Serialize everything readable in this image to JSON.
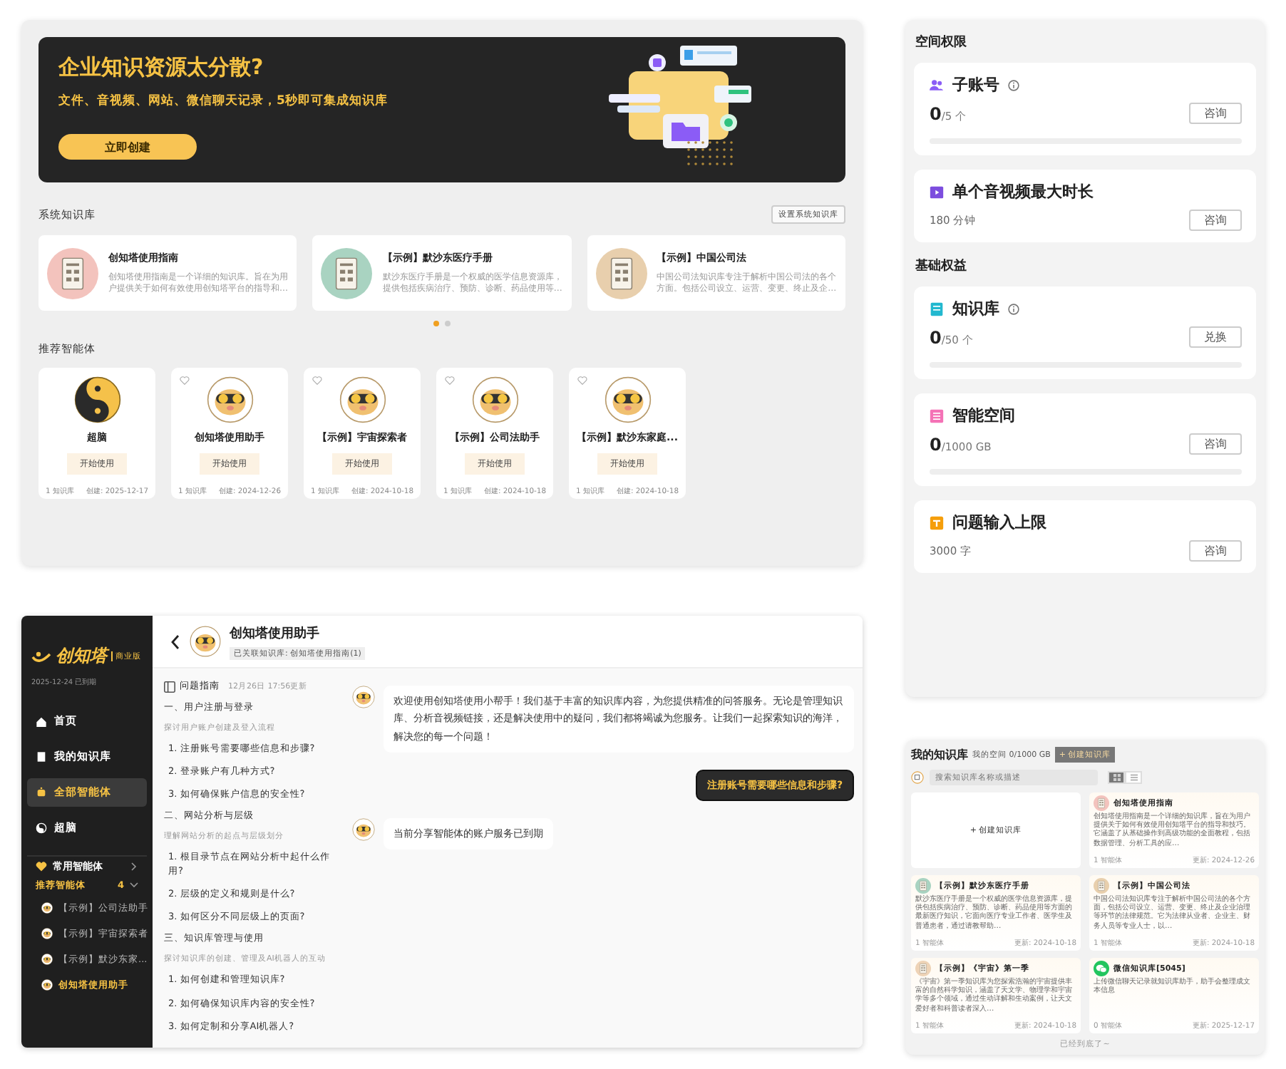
{
  "banner": {
    "title": "企业知识资源太分散?",
    "subtitle": "文件、音视频、网站、微信聊天记录，5秒即可集成知识库",
    "button": "立即创建"
  },
  "system_kb": {
    "heading": "系统知识库",
    "settings_button": "设置系统知识库",
    "cards": [
      {
        "title": "创知塔使用指南",
        "description": "创知塔使用指南是一个详细的知识库。旨在为用户提供关于如何有效使用创知塔平台的指导和…",
        "color": "#f3c3bd"
      },
      {
        "title": "【示例】默沙东医疗手册",
        "description": "默沙东医疗手册是一个权威的医学信息资源库，提供包括疾病治疗、预防、诊断、药品使用等…",
        "color": "#a9d3c1"
      },
      {
        "title": "【示例】中国公司法",
        "description": "中国公司法知识库专注于解析中国公司法的各个方面。包括公司设立、运营、变更、终止及企…",
        "color": "#e8cfad"
      }
    ],
    "pager": [
      {
        "selected": true
      },
      {
        "selected": false
      }
    ]
  },
  "recommended_agents": {
    "heading": "推荐智能体",
    "cards": [
      {
        "kind": "taiji",
        "name": "超脑",
        "button": "开始使用",
        "kb_count": "1 知识库",
        "created": "创建: 2025-12-17"
      },
      {
        "kind": "mascot",
        "name": "创知塔使用助手",
        "button": "开始使用",
        "kb_count": "1 知识库",
        "created": "创建: 2024-12-26"
      },
      {
        "kind": "mascot",
        "name": "【示例】宇宙探索者",
        "button": "开始使用",
        "kb_count": "1 知识库",
        "created": "创建: 2024-10-18"
      },
      {
        "kind": "mascot",
        "name": "【示例】公司法助手",
        "button": "开始使用",
        "kb_count": "1 知识库",
        "created": "创建: 2024-10-18"
      },
      {
        "kind": "mascot",
        "name": "【示例】默沙东家庭...",
        "button": "开始使用",
        "kb_count": "1 知识库",
        "created": "创建: 2024-10-18"
      }
    ]
  },
  "chat_app": {
    "sidebar": {
      "logo": "创知塔",
      "edition": "商业版",
      "expiry": "2025-12-24 已到期",
      "nav": [
        {
          "label": "首页",
          "selected": false
        },
        {
          "label": "我的知识库",
          "selected": false
        },
        {
          "label": "全部智能体",
          "selected": true
        },
        {
          "label": "超脑",
          "selected": false
        }
      ],
      "groups": [
        {
          "label": "常用智能体",
          "expanded": false
        },
        {
          "label": "推荐智能体",
          "count": "4",
          "expanded": true
        }
      ],
      "agents": [
        {
          "label": "【示例】公司法助手",
          "selected": false
        },
        {
          "label": "【示例】宇宙探索者",
          "selected": false
        },
        {
          "label": "【示例】默沙东家...",
          "selected": false
        },
        {
          "label": "创知塔使用助手",
          "selected": true
        }
      ]
    },
    "header": {
      "title": "创知塔使用助手",
      "tag": "已关联知识库: 创知塔使用指南(1)"
    },
    "guide": {
      "title": "问题指南",
      "updated": "12月26日 17:56更新",
      "sections": [
        {
          "title": "一、用户注册与登录",
          "summary": "探讨用户账户创建及登入流程",
          "questions": [
            "1. 注册账号需要哪些信息和步骤?",
            "2. 登录账户有几种方式?",
            "3. 如何确保账户信息的安全性?"
          ]
        },
        {
          "title": "二、网站分析与层级",
          "summary": "理解网站分析的起点与层级划分",
          "questions": [
            "1. 根目录节点在网站分析中起什么作用?",
            "2. 层级的定义和规则是什么?",
            "3. 如何区分不同层级上的页面?"
          ]
        },
        {
          "title": "三、知识库管理与使用",
          "summary": "探讨知识库的创建、管理及AI机器人的互动",
          "questions": [
            "1. 如何创建和管理知识库?",
            "2. 如何确保知识库内容的安全性?",
            "3. 如何定制和分享AI机器人?"
          ]
        }
      ]
    },
    "messages": [
      {
        "kind": "bot",
        "text": "欢迎使用创知塔使用小帮手！我们基于丰富的知识库内容，为您提供精准的问答服务。无论是管理知识库、分析音视频链接，还是解决使用中的疑问，我们都将竭诚为您服务。让我们一起探索知识的海洋，解决您的每一个问题！"
      },
      {
        "kind": "user",
        "text": "注册账号需要哪些信息和步骤?"
      },
      {
        "kind": "bot",
        "text": "当前分享智能体的账户服务已到期"
      }
    ]
  },
  "quota_panel": {
    "sections": [
      {
        "heading": "空间权限",
        "items": [
          {
            "kind": "meter",
            "label": "子账号",
            "info": true,
            "used": "0",
            "limit": "/5 个",
            "level": 0,
            "button": "咨询",
            "color": "#8b5cf6"
          },
          {
            "kind": "plain",
            "label": "单个音视频最大时长",
            "value": "180 分钟",
            "button": "咨询",
            "color": "#7c4dde"
          }
        ]
      },
      {
        "heading": "基础权益",
        "items": [
          {
            "kind": "meter",
            "label": "知识库",
            "info": true,
            "used": "0",
            "limit": "/50 个",
            "level": 0,
            "button": "兑换",
            "color": "#22b8cf"
          },
          {
            "kind": "meter",
            "label": "智能空间",
            "info": false,
            "used": "0",
            "limit": "/1000 GB",
            "level": 0,
            "button": "咨询",
            "color": "#f472b6"
          },
          {
            "kind": "plain",
            "label": "问题输入上限",
            "value": "3000 字",
            "button": "咨询",
            "color": "#f59e0b"
          }
        ]
      }
    ]
  },
  "my_kb": {
    "title": "我的知识库",
    "space": "我的空间 0/1000 GB",
    "create_button": "+ 创建知识库",
    "search": {
      "placeholder": "搜索知识库名称或描述"
    },
    "views": [
      {
        "kind": "grid",
        "selected": true
      },
      {
        "kind": "list",
        "selected": false
      }
    ],
    "create_card": "+ 创建知识库",
    "cards": [
      {
        "kind": "book",
        "title": "创知塔使用指南",
        "description": "创知塔使用指南是一个详细的知识库，旨在为用户提供关于如何有效使用创知塔平台的指导和技巧。它涵盖了从基础操作到高级功能的全面教程，包括数据管理、分析工具的应…",
        "agents": "1 智能体",
        "updated": "更新: 2024-12-26",
        "color": "#f3c3bd"
      },
      {
        "kind": "book",
        "title": "【示例】默沙东医疗手册",
        "description": "默沙东医疗手册是一个权威的医学信息资源库，提供包括疾病治疗、预防、诊断、药品使用等方面的最新医疗知识，它面向医疗专业工作者、医学生及普通患者，通过请教帮助…",
        "agents": "1 智能体",
        "updated": "更新: 2024-10-18",
        "color": "#a9d3c1"
      },
      {
        "kind": "book",
        "title": "【示例】中国公司法",
        "description": "中国公司法知识库专注于解析中国公司法的各个方面，包括公司设立、运营、变更、终止及企业治理等环节的法律规范。它为法律从业者、企业主、财务人员等专业人士，以…",
        "agents": "1 智能体",
        "updated": "更新: 2024-10-18",
        "color": "#e8cfad"
      },
      {
        "kind": "book",
        "title": "【示例】《宇宙》第一季",
        "description": "《宇宙》第一季知识库为您探索浩瀚的宇宙提供丰富的自然科学知识，涵盖了天文学、物理学和宇宙学等多个领域，通过生动详解和生动案例，让天文爱好者和科普读者深入…",
        "agents": "1 智能体",
        "updated": "更新: 2024-10-18",
        "color": "#eed3b6"
      },
      {
        "kind": "wechat",
        "title": "微信知识库[5045]",
        "description": "上传微信聊天记录就知识库助手，助手会整理成文本信息",
        "agents": "0 智能体",
        "updated": "更新: 2025-12-17",
        "color": "#22c55e"
      }
    ],
    "footer": "已经到底了~"
  }
}
